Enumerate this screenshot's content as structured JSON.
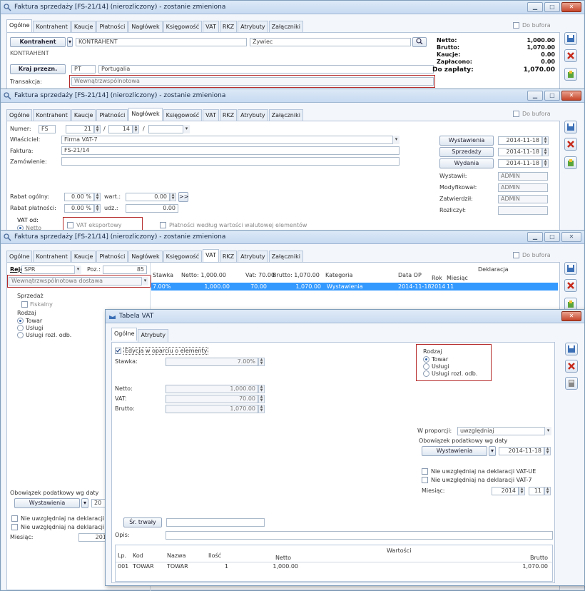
{
  "w1": {
    "title": "Faktura sprzedaży [FS-21/14] (nierozliczony) - zostanie zmieniona",
    "tabs": [
      "Ogólne",
      "Kontrahent",
      "Kaucje",
      "Płatności",
      "Nagłówek",
      "Księgowość",
      "VAT",
      "RKZ",
      "Atrybuty",
      "Załączniki"
    ],
    "do_bufora": "Do bufora",
    "kontrahent_btn": "Kontrahent",
    "kontrahent_val": "KONTRAHENT",
    "city": "Żywiec",
    "kontrahent_name": "KONTRAHENT",
    "kraj_btn": "Kraj przezn.",
    "kraj_code": "PT",
    "kraj_name": "Portugalia",
    "transakcja_lbl": "Transakcja:",
    "transakcja_val": "Wewnątrzwspólnotowa",
    "netto_lbl": "Netto:",
    "netto": "1,000.00",
    "brutto_lbl": "Brutto:",
    "brutto": "1,070.00",
    "kaucje_lbl": "Kaucje:",
    "kaucje": "0.00",
    "zaplacono_lbl": "Zapłacono:",
    "zaplacono": "0.00",
    "do_zaplaty_lbl": "Do zapłaty:",
    "do_zaplaty": "1,070.00"
  },
  "w2": {
    "title": "Faktura sprzedaży [FS-21/14] (nierozliczony) - zostanie zmieniona",
    "do_bufora": "Do bufora",
    "numer_lbl": "Numer:",
    "numer_prefix": "FS",
    "numer_a": "21",
    "numer_b": "14",
    "wlasciciel_lbl": "Właściciel:",
    "wlasciciel": "Firma VAT-7",
    "faktura_lbl": "Faktura:",
    "faktura": "FS-21/14",
    "zamowienie_lbl": "Zamówienie:",
    "wystawienia_btn": "Wystawienia",
    "wystawienia_date": "2014-11-18",
    "sprzedazy_btn": "Sprzedaży",
    "sprzedazy_date": "2014-11-18",
    "wydania_btn": "Wydania",
    "wydania_date": "2014-11-18",
    "wystawil_lbl": "Wystawił:",
    "wystawil": "ADMIN",
    "modyfikowal_lbl": "Modyfikował:",
    "modyfikowal": "ADMIN",
    "zatwierdzil_lbl": "Zatwierdził:",
    "zatwierdzil": "ADMIN",
    "rozliczyl_lbl": "Rozliczył:",
    "rabat_ogolny_lbl": "Rabat ogólny:",
    "rabat_ogolny": "0.00 %",
    "wart_lbl": "wart.:",
    "wart": "0.00",
    "rabat_platnosci_lbl": "Rabat płatności:",
    "rabat_platnosci": "0.00 %",
    "udz_lbl": "udz.:",
    "udz": "0.00",
    "vat_od_lbl": "VAT od:",
    "netto_radio": "Netto",
    "vat_eksportowy": "VAT eksportowy",
    "platnosci_wg": "Płatności według wartości walutowej elementów"
  },
  "w3": {
    "title": "Faktura sprzedaży [FS-21/14] (nierozliczony) - zostanie zmieniona",
    "do_bufora": "Do bufora",
    "rejestr_lbl": "Rejestr:",
    "rejestr": "SPR",
    "poz_lbl": "Poz.:",
    "poz": "85",
    "transakcja": "Wewnątrzwspólnotowa dostawa",
    "sprzedaz_lbl": "Sprzedaż",
    "fiskalny": "Fiskalny",
    "rodzaj_lbl": "Rodzaj",
    "towar": "Towar",
    "uslugi": "Usługi",
    "uslugi_rozl": "Usługi rozl. odb.",
    "cols": {
      "stawka": "Stawka",
      "netto": "Netto: 1,000.00",
      "vat": "Vat: 70.00",
      "brutto": "Brutto: 1,070.00",
      "kategoria": "Kategoria",
      "data_op": "Data OP",
      "deklaracja": "Deklaracja",
      "rok": "Rok",
      "miesiac": "Miesiąc"
    },
    "row": {
      "stawka": "7.00%",
      "netto": "1,000.00",
      "vat": "70.00",
      "brutto": "1,070.00",
      "kategoria": "Wystawienia",
      "data_op": "2014-11-18",
      "rok": "2014",
      "miesiac": "11"
    },
    "obowiazek_lbl": "Obowiązek podatkowy wg daty",
    "wystawienia_btn": "Wystawienia",
    "obowiazek_date_partial": "20",
    "nie_uwzgl_1": "Nie uwzględniaj na deklaracji",
    "nie_uwzgl_2": "Nie uwzględniaj na deklaracji",
    "miesiac_lbl": "Miesiąc:",
    "miesiac_rok": "2014"
  },
  "w4": {
    "title": "Tabela VAT",
    "tabs": [
      "Ogólne",
      "Atrybuty"
    ],
    "edycja": "Edycja w oparciu o elementy",
    "stawka_lbl": "Stawka:",
    "stawka": "7.00%",
    "netto_lbl": "Netto:",
    "netto": "1,000.00",
    "vat_lbl": "VAT:",
    "vat": "70.00",
    "brutto_lbl": "Brutto:",
    "brutto": "1,070.00",
    "rodzaj_lbl": "Rodzaj",
    "towar": "Towar",
    "uslugi": "Usługi",
    "uslugi_rozl": "Usługi rozl. odb.",
    "w_proporcji_lbl": "W proporcji:",
    "w_proporcji": "uwzględniaj",
    "obowiazek_lbl": "Obowiązek podatkowy wg daty",
    "wystawienia_btn": "Wystawienia",
    "obowiazek_date": "2014-11-18",
    "nie_vat_ue": "Nie uwzględniaj na deklaracji VAT-UE",
    "nie_vat7": "Nie uwzględniaj na deklaracji VAT-7",
    "miesiac_lbl": "Miesiąc:",
    "rok": "2014",
    "mies": "11",
    "sr_trwaly": "Śr. trwały",
    "opis_lbl": "Opis:",
    "cols": {
      "lp": "Lp.",
      "kod": "Kod",
      "nazwa": "Nazwa",
      "ilosc": "Ilość",
      "wartosci": "Wartości",
      "netto": "Netto",
      "brutto": "Brutto"
    },
    "row": {
      "lp": "001",
      "kod": "TOWAR",
      "nazwa": "TOWAR",
      "ilosc": "1",
      "netto": "1,000.00",
      "brutto": "1,070.00"
    }
  }
}
